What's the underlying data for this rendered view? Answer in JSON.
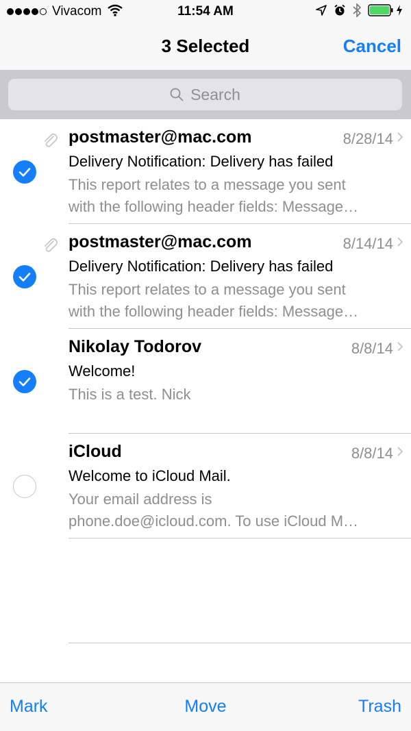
{
  "status_bar": {
    "signal_bars": 4,
    "signal_total": 5,
    "carrier": "Vivacom",
    "time": "11:54 AM",
    "battery_color": "#4cd964",
    "icons": [
      "wifi-icon",
      "location-icon",
      "alarm-icon",
      "bluetooth-icon",
      "battery-icon",
      "charging-icon"
    ]
  },
  "nav": {
    "title": "3 Selected",
    "cancel_label": "Cancel"
  },
  "search": {
    "placeholder": "Search"
  },
  "messages": [
    {
      "sender": "postmaster@mac.com",
      "date": "8/28/14",
      "subject": "Delivery Notification: Delivery has failed",
      "preview_line1": "This report relates to a message you sent",
      "preview_line2": "with the following header fields: Message…",
      "has_attachment": true,
      "selected": true
    },
    {
      "sender": "postmaster@mac.com",
      "date": "8/14/14",
      "subject": "Delivery Notification: Delivery has failed",
      "preview_line1": "This report relates to a message you sent",
      "preview_line2": "with the following header fields: Message…",
      "has_attachment": true,
      "selected": true
    },
    {
      "sender": "Nikolay Todorov",
      "date": "8/8/14",
      "subject": "Welcome!",
      "preview_line1": "This is a test. Nick",
      "preview_line2": "",
      "has_attachment": false,
      "selected": true
    },
    {
      "sender": "iCloud",
      "date": "8/8/14",
      "subject": "Welcome to iCloud Mail.",
      "preview_line1": "Your email address is",
      "preview_line2": "phone.doe@icloud.com. To use iCloud M…",
      "has_attachment": false,
      "selected": false
    }
  ],
  "toolbar": {
    "mark_label": "Mark",
    "move_label": "Move",
    "trash_label": "Trash"
  },
  "colors": {
    "accent": "#147efb",
    "secondary_text": "#8e8e93"
  }
}
